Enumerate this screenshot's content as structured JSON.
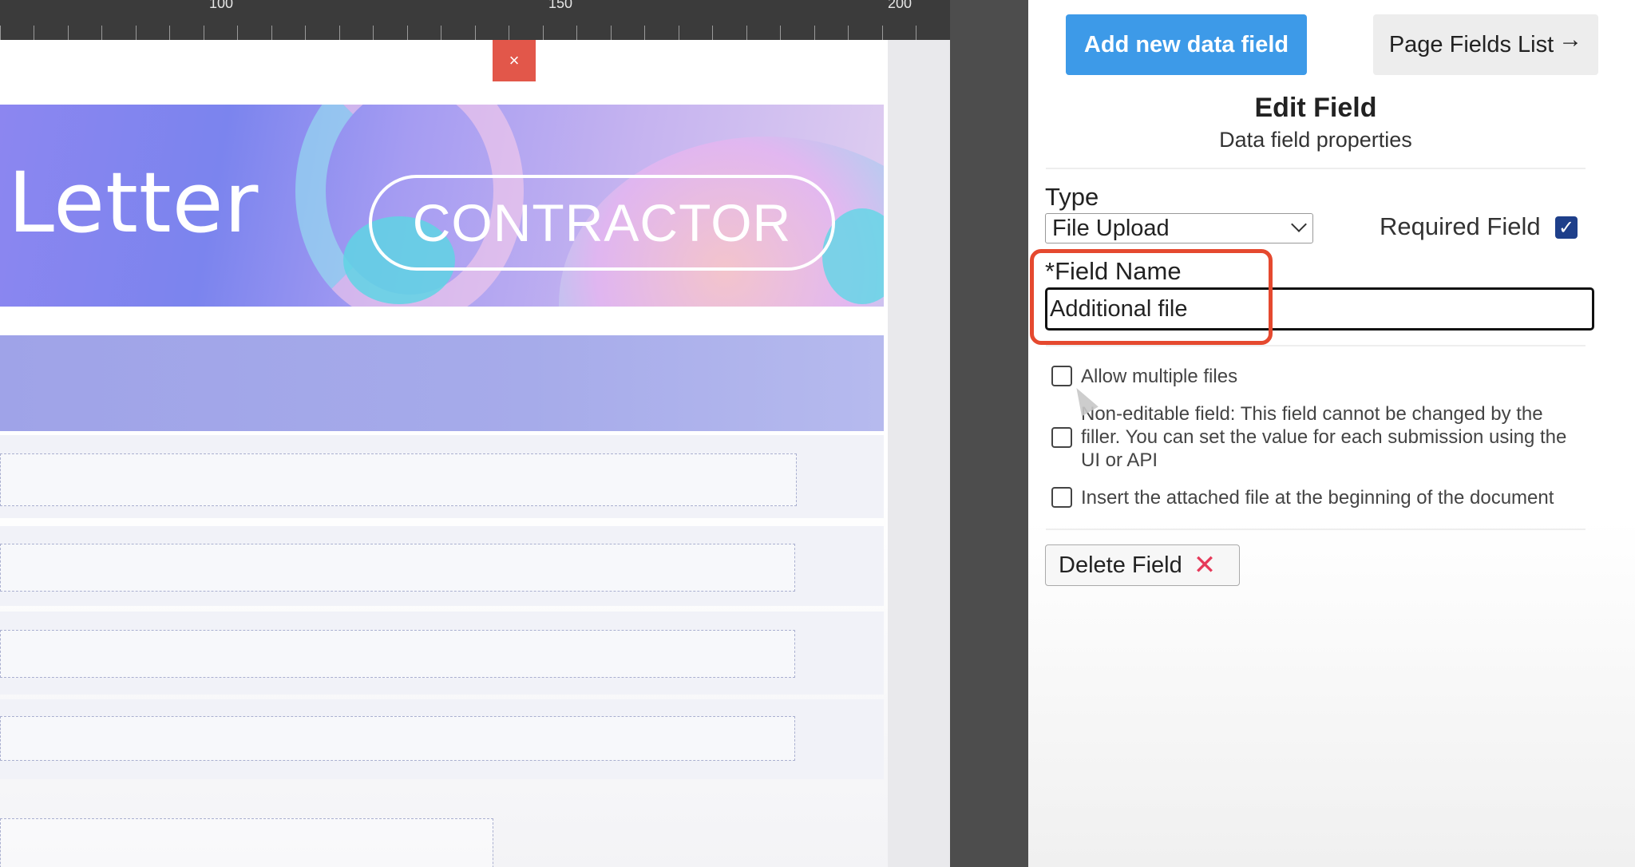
{
  "ruler": {
    "labels": [
      "100",
      "150",
      "200"
    ]
  },
  "editor": {
    "close_glyph": "×",
    "banner_title": "Letter",
    "banner_pill": "CONTRACTOR"
  },
  "panel": {
    "add_button": "Add new data field",
    "list_button": "Page Fields List",
    "list_arrow": "→",
    "title": "Edit Field",
    "subtitle": "Data field properties",
    "type_label": "Type",
    "type_value": "File Upload",
    "required_label": "Required Field",
    "required_checked": true,
    "required_check_glyph": "✓",
    "field_name_label": "*Field Name",
    "field_name_value": "Additional file",
    "options": [
      {
        "label": "Allow multiple files",
        "checked": false
      },
      {
        "label": "Non-editable field: This field cannot be changed by the filler. You can set the value for each submission using the UI or API",
        "checked": false
      },
      {
        "label": "Insert the attached file at the beginning of the document",
        "checked": false
      }
    ],
    "delete_button": "Delete Field",
    "delete_glyph": "✕"
  },
  "colors": {
    "accent": "#3d9ae8",
    "highlight": "#e5492f",
    "close_button": "#e2574a",
    "delete_icon": "#e63a5a",
    "checkbox_checked": "#1e3f8a"
  }
}
